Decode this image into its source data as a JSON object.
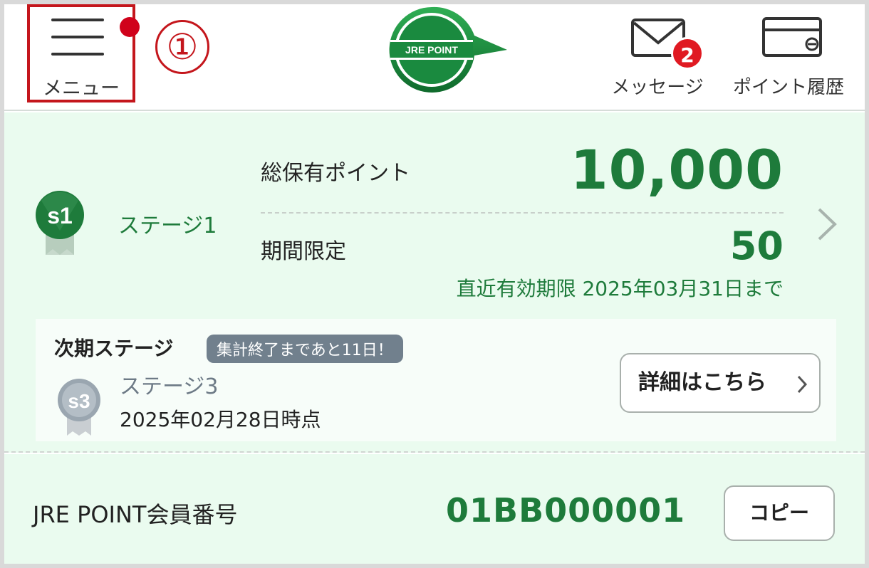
{
  "header": {
    "menu_label": "メニュー",
    "annotation_number": "①",
    "logo_text": "JRE POINT",
    "message_label": "メッセージ",
    "message_badge": "2",
    "history_label": "ポイント履歴"
  },
  "points": {
    "stage_medal": "s1",
    "stage_label": "ステージ1",
    "total_label": "総保有ポイント",
    "total_value": "10,000",
    "limited_label": "期間限定",
    "limited_value": "50",
    "expiry_text": "直近有効期限 2025年03月31日まで"
  },
  "next_stage": {
    "title": "次期ステージ",
    "tag": "集計終了まであと11日！",
    "medal": "s3",
    "stage_label": "ステージ3",
    "as_of": "2025年02月28日時点",
    "detail_button": "詳細はこちら"
  },
  "member": {
    "label": "JRE POINT会員番号",
    "number": "01BB000001",
    "copy_button": "コピー"
  },
  "colors": {
    "brand_green": "#1e7b3b",
    "card_bg": "#eafbef",
    "highlight_red": "#c4161c",
    "badge_red": "#e01a22",
    "tag_gray": "#71808d"
  }
}
